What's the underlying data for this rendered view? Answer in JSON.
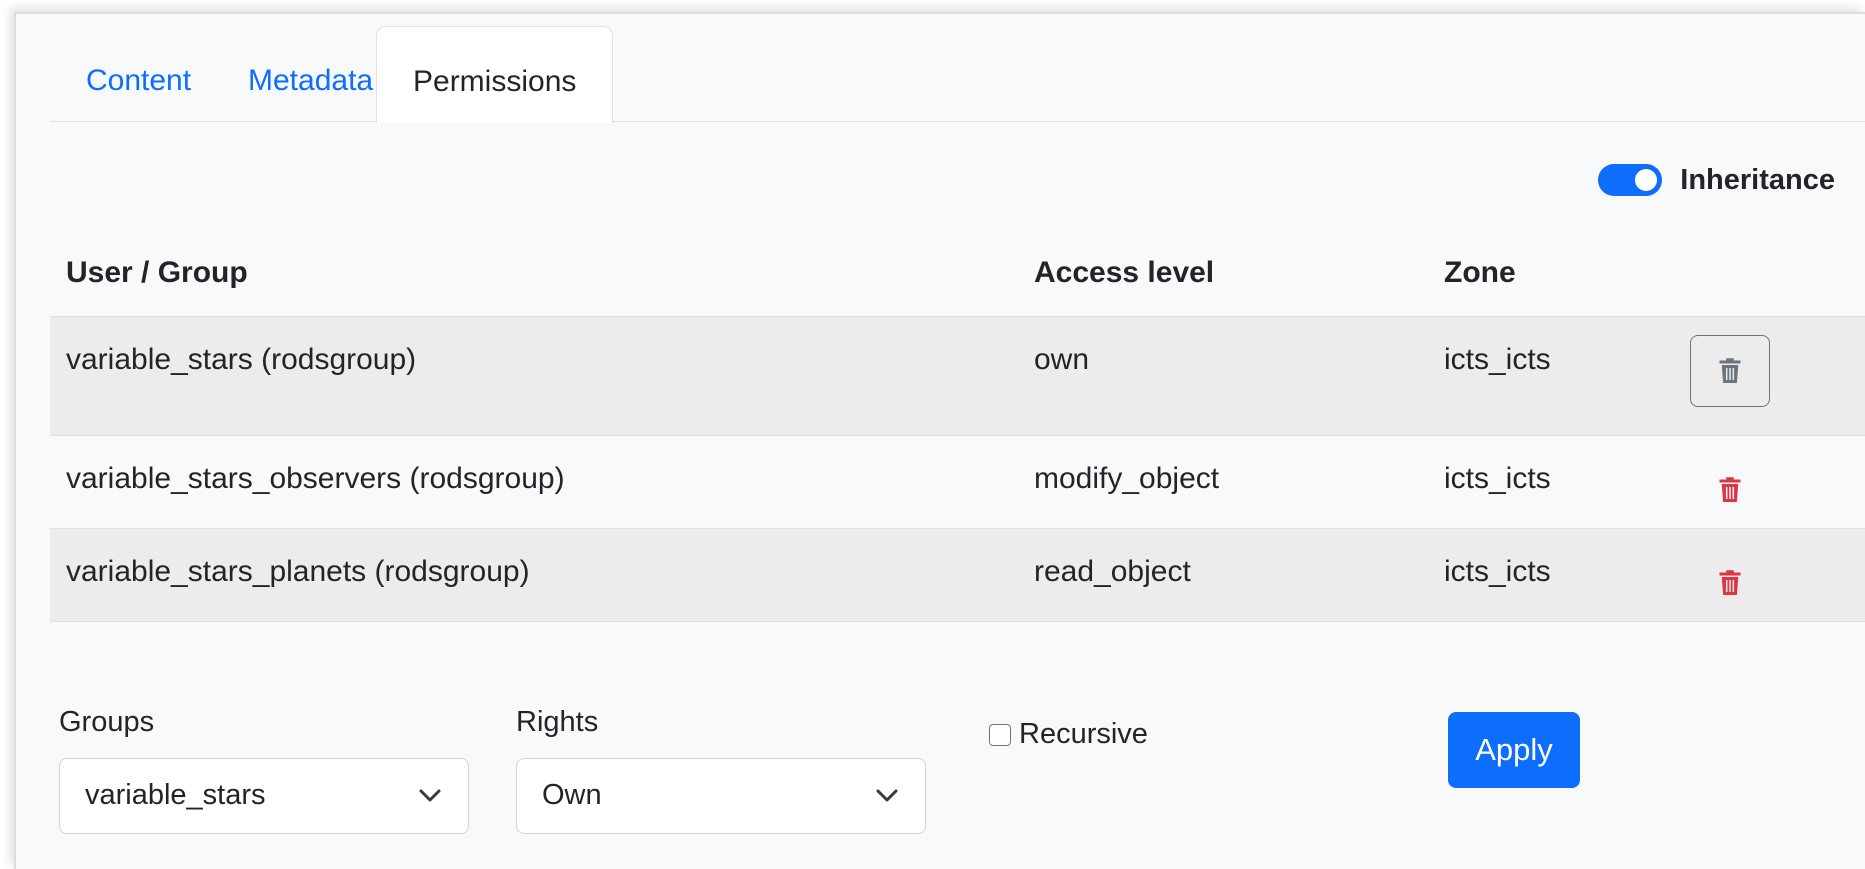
{
  "tabs": [
    {
      "label": "Content",
      "active": false
    },
    {
      "label": "Metadata",
      "active": false
    },
    {
      "label": "Permissions",
      "active": true
    }
  ],
  "inheritance": {
    "label": "Inheritance",
    "enabled": true
  },
  "table": {
    "headers": {
      "user": "User / Group",
      "access": "Access level",
      "zone": "Zone"
    },
    "rows": [
      {
        "user": "variable_stars (rodsgroup)",
        "access": "own",
        "zone": "icts_icts",
        "delete_style": "outlined"
      },
      {
        "user": "variable_stars_observers (rodsgroup)",
        "access": "modify_object",
        "zone": "icts_icts",
        "delete_style": "danger"
      },
      {
        "user": "variable_stars_planets (rodsgroup)",
        "access": "read_object",
        "zone": "icts_icts",
        "delete_style": "danger"
      }
    ]
  },
  "form": {
    "groups_label": "Groups",
    "groups_value": "variable_stars",
    "rights_label": "Rights",
    "rights_value": "Own",
    "recursive_label": "Recursive",
    "recursive_checked": false,
    "apply_label": "Apply"
  },
  "colors": {
    "accent": "#0d6efd",
    "danger": "#dc3545",
    "secondary": "#6c757d"
  }
}
